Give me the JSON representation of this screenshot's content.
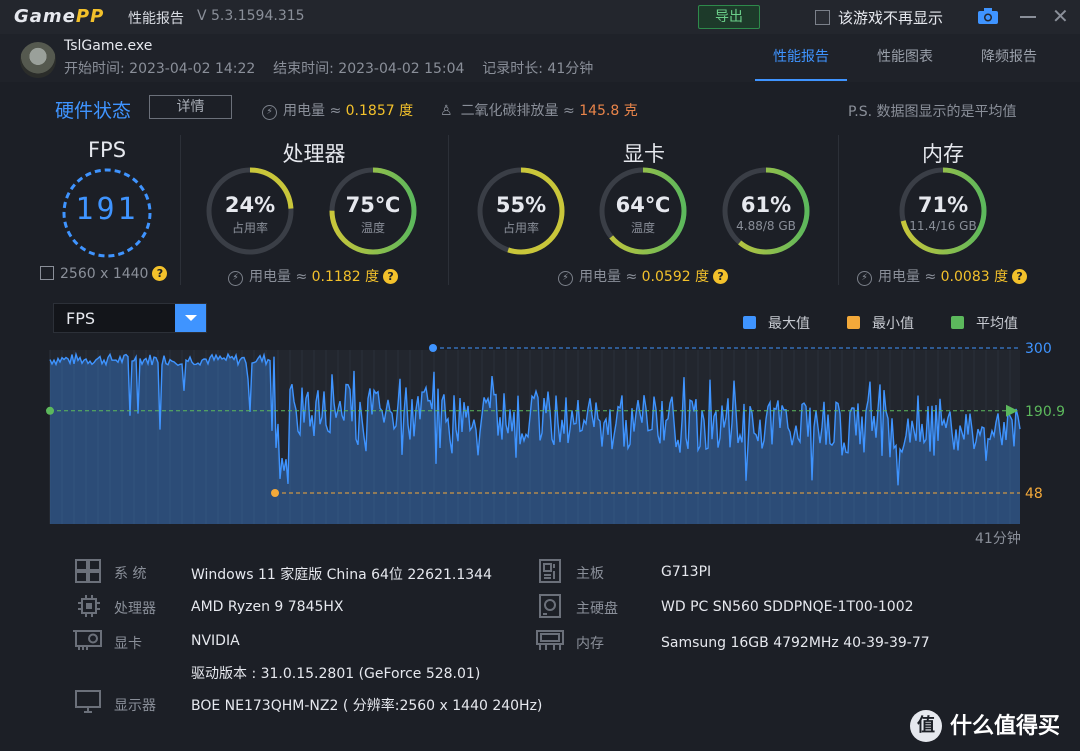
{
  "titlebar": {
    "logo_a": "Game",
    "logo_b": "PP",
    "title": "性能报告",
    "version": "V 5.3.1594.315",
    "export_label": "导出",
    "no_display_label": "该游戏不再显示"
  },
  "header": {
    "exe": "TslGame.exe",
    "times": "开始时间: 2023-04-02 14:22    结束时间: 2023-04-02 15:04    记录时长: 41分钟",
    "tabs": [
      "性能报告",
      "性能图表",
      "降频报告"
    ]
  },
  "hardware": {
    "title": "硬件状态",
    "detail_label": "详情",
    "energy_label": "用电量 ≈",
    "energy_value": "0.1857 度",
    "co2_label": "二氧化碳排放量 ≈",
    "co2_value": "145.8 克",
    "ps_note": "P.S. 数据图显示的是平均值"
  },
  "fps": {
    "title": "FPS",
    "value": "191",
    "resolution": "2560 x 1440"
  },
  "cpu": {
    "title": "处理器",
    "usage": "24%",
    "usage_label": "占用率",
    "usage_frac": 0.24,
    "temp": "75℃",
    "temp_label": "温度",
    "temp_frac": 0.75,
    "power": "0.1182 度"
  },
  "gpu": {
    "title": "显卡",
    "usage": "55%",
    "usage_label": "占用率",
    "usage_frac": 0.55,
    "temp": "64℃",
    "temp_label": "温度",
    "temp_frac": 0.64,
    "vram": "61%",
    "vram_sub": "4.88/8 GB",
    "vram_frac": 0.61,
    "power": "0.0592 度"
  },
  "memory": {
    "title": "内存",
    "usage": "71%",
    "usage_sub": "11.4/16 GB",
    "usage_frac": 0.71,
    "power": "0.0083 度"
  },
  "power_label": "用电量 ≈",
  "chart_select": "FPS",
  "legend": {
    "max": "最大值",
    "min": "最小值",
    "avg": "平均值"
  },
  "colors": {
    "max": "#3f94ff",
    "min": "#f3a93a",
    "avg": "#5cb85c"
  },
  "chart_data": {
    "type": "line",
    "series_name": "FPS",
    "duration_label": "41分钟",
    "max": 300,
    "min": 48,
    "avg": 190.9,
    "max_label": "300",
    "min_label": "48",
    "avg_label": "190.9"
  },
  "system": {
    "os_label": "系  统",
    "os": "Windows 11 家庭版 China 64位 22621.1344",
    "cpu_label": "处理器",
    "cpu": "AMD Ryzen 9 7845HX",
    "gpu_label": "显卡",
    "gpu": "NVIDIA",
    "driver": "驱动版本 : 31.0.15.2801 (GeForce 528.01)",
    "display_label": "显示器",
    "display": "BOE NE173QHM-NZ2 ( 分辨率:2560 x 1440 240Hz)",
    "board_label": "主板",
    "board": "G713PI",
    "disk_label": "主硬盘",
    "disk": "WD PC SN560 SDDPNQE-1T00-1002",
    "mem_label": "内存",
    "mem": "Samsung 16GB 4792MHz 40-39-39-77"
  },
  "watermark": {
    "glyph": "值",
    "text": "什么值得买"
  }
}
